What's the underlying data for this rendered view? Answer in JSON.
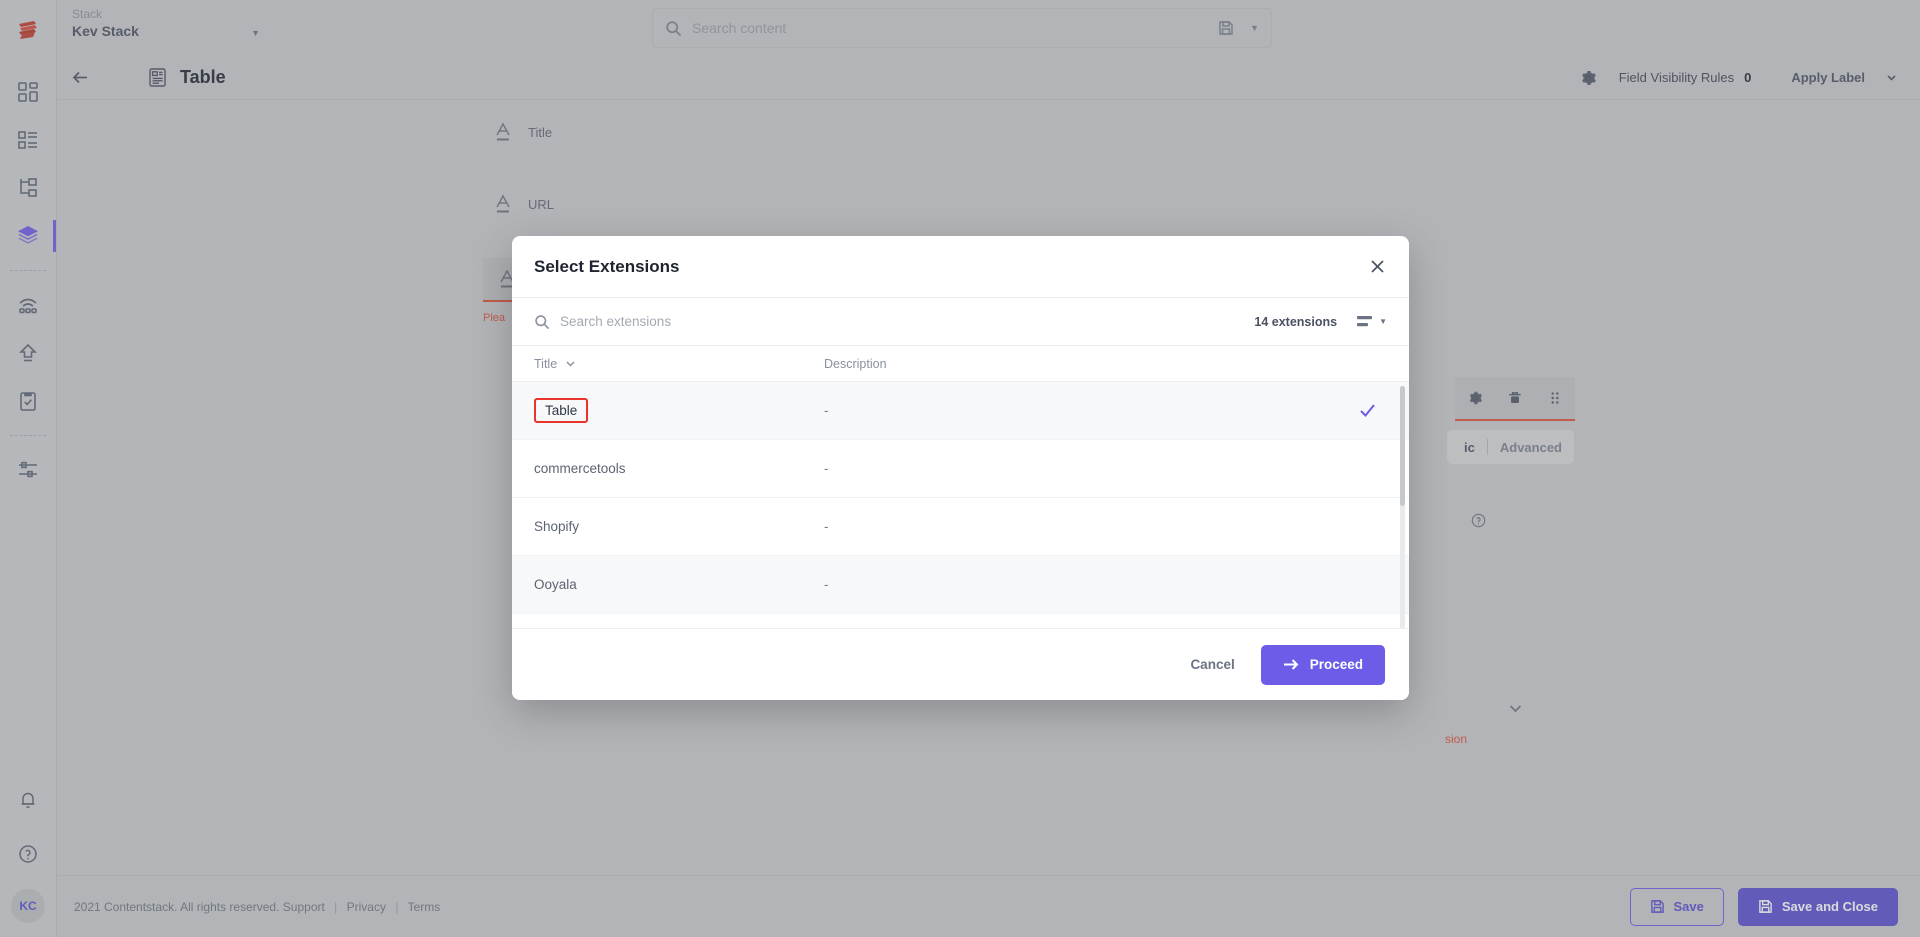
{
  "app": {
    "stack": {
      "label": "Stack",
      "name": "Kev Stack"
    },
    "search": {
      "placeholder": "Search content"
    }
  },
  "sidebar": {
    "items": [
      {
        "name": "dashboard",
        "icon": "dashboard-icon"
      },
      {
        "name": "content-types",
        "icon": "content-types-icon"
      },
      {
        "name": "structure",
        "icon": "hierarchy-icon"
      },
      {
        "name": "stacks",
        "icon": "layers-icon",
        "active": true
      },
      {
        "name": "live-preview",
        "icon": "broadcast-icon"
      },
      {
        "name": "publish-queue",
        "icon": "upload-icon"
      },
      {
        "name": "tasks",
        "icon": "clipboard-check-icon"
      },
      {
        "name": "settings",
        "icon": "sliders-icon"
      }
    ],
    "bottom": [
      {
        "name": "notifications",
        "icon": "bell-icon"
      },
      {
        "name": "help",
        "icon": "help-circle-icon"
      }
    ],
    "avatar": "KC"
  },
  "header": {
    "title": "Table",
    "field_visibility_rules_label": "Field Visibility Rules",
    "field_visibility_rules_count": "0",
    "apply_label": "Apply Label"
  },
  "canvas": {
    "fields": [
      {
        "name": "Title",
        "icon": "single-line-text-icon"
      },
      {
        "name": "URL",
        "icon": "single-line-text-icon"
      }
    ],
    "error_field_error": "Plea",
    "tabs": [
      {
        "label": "ic",
        "active": true
      },
      {
        "label": "Advanced",
        "active": false
      }
    ],
    "red_note": "sion"
  },
  "modal": {
    "title": "Select Extensions",
    "search_placeholder": "Search extensions",
    "count_label": "14 extensions",
    "columns": {
      "title": "Title",
      "description": "Description"
    },
    "rows": [
      {
        "title": "Table",
        "description": "-",
        "selected": true,
        "highlighted": true
      },
      {
        "title": "commercetools",
        "description": "-",
        "selected": false,
        "highlighted": false
      },
      {
        "title": "Shopify",
        "description": "-",
        "selected": false,
        "highlighted": false
      },
      {
        "title": "Ooyala",
        "description": "-",
        "selected": false,
        "highlighted": false
      }
    ],
    "cancel_label": "Cancel",
    "proceed_label": "Proceed"
  },
  "footer": {
    "copyright": "2021 Contentstack. All rights reserved.",
    "support": "Support",
    "privacy": "Privacy",
    "terms": "Terms",
    "save_label": "Save",
    "save_close_label": "Save and Close"
  },
  "colors": {
    "accent": "#6c5ce7",
    "accent_dark": "#5b4fd0",
    "error": "#e0503a",
    "highlight": "#e8342a",
    "page_bg": "#c9cbcd"
  }
}
